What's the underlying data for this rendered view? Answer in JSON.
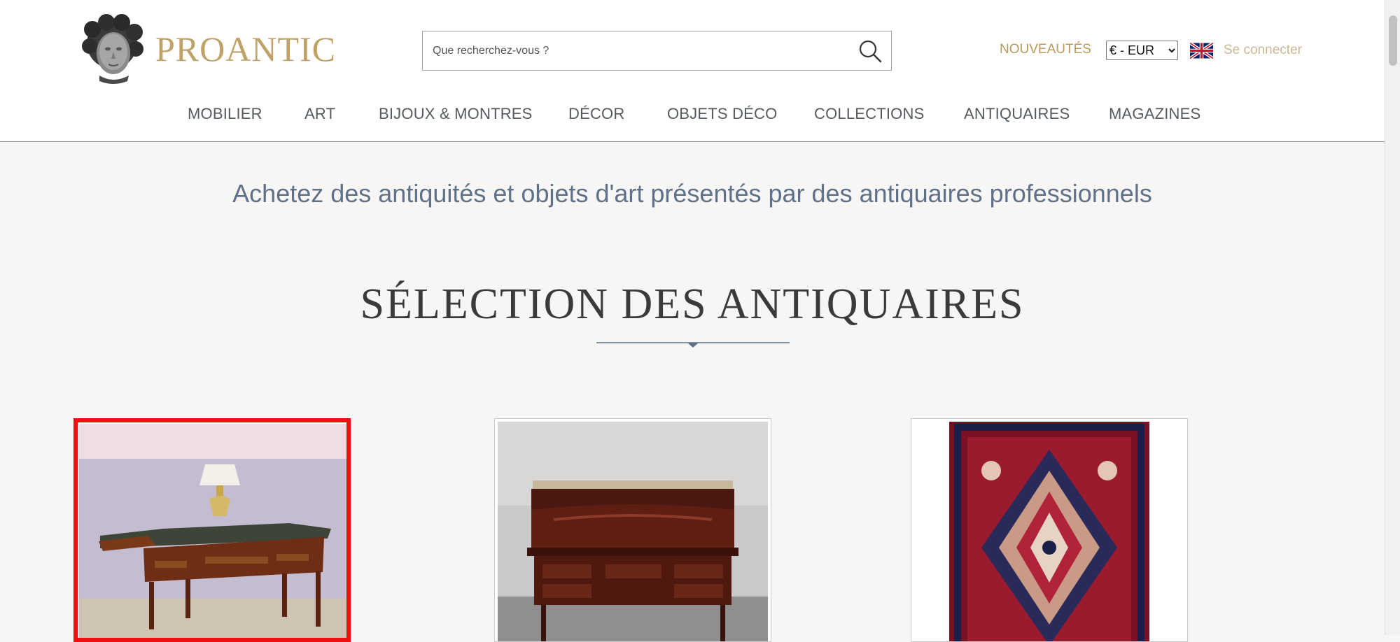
{
  "header": {
    "brand": "PROANTIC",
    "logo_icon": "sculpted-head-logo",
    "search": {
      "placeholder": "Que recherchez-vous ?",
      "value": "",
      "icon": "search-icon"
    },
    "new_label": "NOUVEAUTÉS",
    "currency": {
      "selected": "€ - EUR",
      "options": [
        "€ - EUR"
      ]
    },
    "language_flag": "uk-flag-icon",
    "login_label": "Se connecter"
  },
  "nav": {
    "items": [
      {
        "label": "MOBILIER"
      },
      {
        "label": "ART"
      },
      {
        "label": "BIJOUX & MONTRES"
      },
      {
        "label": "DÉCOR"
      },
      {
        "label": "OBJETS DÉCO"
      },
      {
        "label": "COLLECTIONS"
      },
      {
        "label": "ANTIQUAIRES"
      },
      {
        "label": "MAGAZINES"
      }
    ]
  },
  "main": {
    "tagline": "Achetez des antiquités et objets d'art présentés par des antiquaires professionnels",
    "section_title": "SÉLECTION DES ANTIQUAIRES",
    "products": [
      {
        "image": "writing-desk-with-lamp-photo",
        "selected": true
      },
      {
        "image": "roll-top-desk-photo",
        "selected": false
      },
      {
        "image": "persian-rug-photo",
        "selected": false
      }
    ]
  },
  "colors": {
    "brand_gold": "#bfa267",
    "nav_text": "#555a61",
    "tagline_blue": "#5f7189",
    "selection_border": "#ee1010",
    "background": "#f7f6f4"
  }
}
